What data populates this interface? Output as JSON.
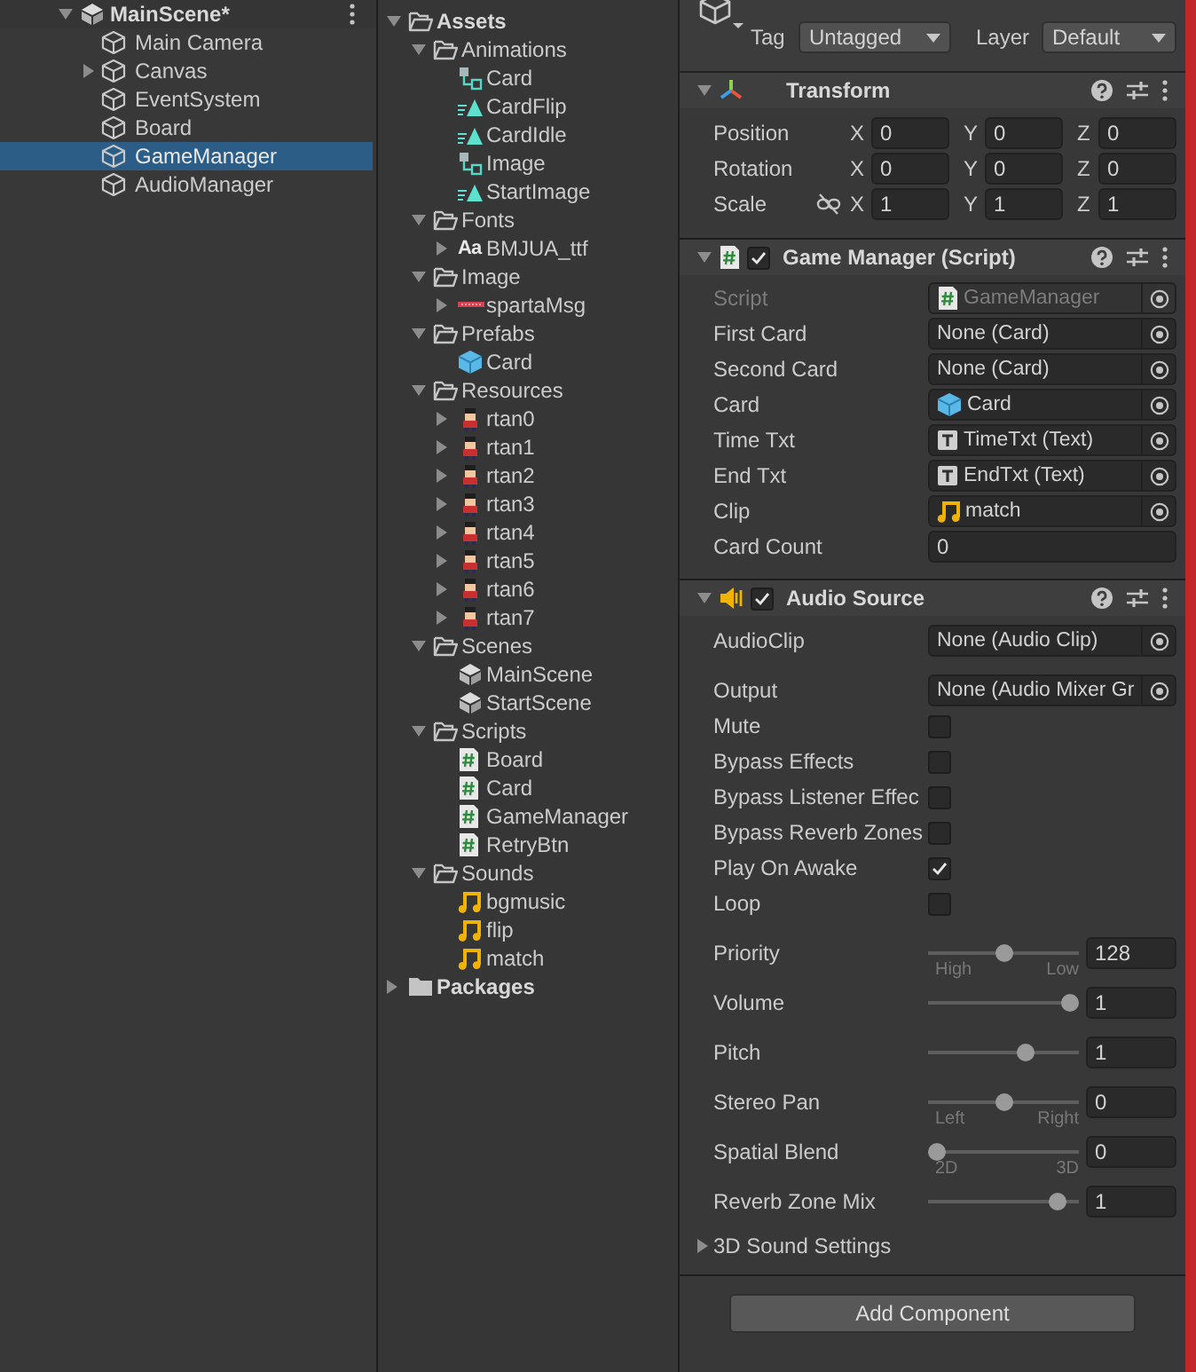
{
  "hierarchy": {
    "scene": {
      "name": "MainScene*",
      "expanded": true
    },
    "objects": [
      {
        "name": "Main Camera",
        "selected": false,
        "collapsed": false
      },
      {
        "name": "Canvas",
        "selected": false,
        "collapsed": true
      },
      {
        "name": "EventSystem",
        "selected": false,
        "collapsed": false
      },
      {
        "name": "Board",
        "selected": false,
        "collapsed": false
      },
      {
        "name": "GameManager",
        "selected": true,
        "collapsed": false
      },
      {
        "name": "AudioManager",
        "selected": false,
        "collapsed": false
      }
    ]
  },
  "project": {
    "tree": [
      {
        "name": "Assets",
        "kind": "folder",
        "expanded": true,
        "children": [
          {
            "name": "Animations",
            "kind": "folder",
            "expanded": true,
            "children": [
              {
                "name": "Card",
                "kind": "animator"
              },
              {
                "name": "CardFlip",
                "kind": "animclip"
              },
              {
                "name": "CardIdle",
                "kind": "animclip"
              },
              {
                "name": "Image",
                "kind": "animator"
              },
              {
                "name": "StartImage",
                "kind": "animclip"
              }
            ]
          },
          {
            "name": "Fonts",
            "kind": "folder",
            "expanded": true,
            "children": [
              {
                "name": "BMJUA_ttf",
                "kind": "font",
                "badge": "Aa",
                "expanded": false
              }
            ]
          },
          {
            "name": "Image",
            "kind": "folder",
            "expanded": true,
            "children": [
              {
                "name": "spartaMsg",
                "kind": "sprite",
                "expanded": false
              }
            ]
          },
          {
            "name": "Prefabs",
            "kind": "folder",
            "expanded": true,
            "children": [
              {
                "name": "Card",
                "kind": "prefab"
              }
            ]
          },
          {
            "name": "Resources",
            "kind": "folder",
            "expanded": true,
            "children": [
              {
                "name": "rtan0",
                "kind": "character",
                "expanded": false
              },
              {
                "name": "rtan1",
                "kind": "character",
                "expanded": false
              },
              {
                "name": "rtan2",
                "kind": "character",
                "expanded": false
              },
              {
                "name": "rtan3",
                "kind": "character",
                "expanded": false
              },
              {
                "name": "rtan4",
                "kind": "character",
                "expanded": false
              },
              {
                "name": "rtan5",
                "kind": "character",
                "expanded": false
              },
              {
                "name": "rtan6",
                "kind": "character",
                "expanded": false
              },
              {
                "name": "rtan7",
                "kind": "character",
                "expanded": false
              }
            ]
          },
          {
            "name": "Scenes",
            "kind": "folder",
            "expanded": true,
            "children": [
              {
                "name": "MainScene",
                "kind": "scene"
              },
              {
                "name": "StartScene",
                "kind": "scene"
              }
            ]
          },
          {
            "name": "Scripts",
            "kind": "folder",
            "expanded": true,
            "children": [
              {
                "name": "Board",
                "kind": "script"
              },
              {
                "name": "Card",
                "kind": "script"
              },
              {
                "name": "GameManager",
                "kind": "script"
              },
              {
                "name": "RetryBtn",
                "kind": "script"
              }
            ]
          },
          {
            "name": "Sounds",
            "kind": "folder",
            "expanded": true,
            "children": [
              {
                "name": "bgmusic",
                "kind": "audio"
              },
              {
                "name": "flip",
                "kind": "audio"
              },
              {
                "name": "match",
                "kind": "audio"
              }
            ]
          }
        ]
      },
      {
        "name": "Packages",
        "kind": "folder",
        "expanded": false
      }
    ]
  },
  "inspector": {
    "header": {
      "tag_label": "Tag",
      "tag": "Untagged",
      "layer_label": "Layer",
      "layer": "Default"
    },
    "components": [
      {
        "kind": "transform",
        "title": "Transform",
        "expanded": true,
        "rows": [
          {
            "label": "Position",
            "axes": [
              {
                "axis": "X",
                "value": "0"
              },
              {
                "axis": "Y",
                "value": "0"
              },
              {
                "axis": "Z",
                "value": "0"
              }
            ]
          },
          {
            "label": "Rotation",
            "axes": [
              {
                "axis": "X",
                "value": "0"
              },
              {
                "axis": "Y",
                "value": "0"
              },
              {
                "axis": "Z",
                "value": "0"
              }
            ]
          },
          {
            "label": "Scale",
            "constrain_proportions": false,
            "axes": [
              {
                "axis": "X",
                "value": "1"
              },
              {
                "axis": "Y",
                "value": "1"
              },
              {
                "axis": "Z",
                "value": "1"
              }
            ]
          }
        ]
      },
      {
        "kind": "script",
        "title": "Game Manager (Script)",
        "enabled": true,
        "expanded": true,
        "fields": [
          {
            "kind": "script",
            "label": "Script",
            "value": "GameManager",
            "disabled": true
          },
          {
            "kind": "object",
            "label": "First Card",
            "value": "None (Card)",
            "disabled": false
          },
          {
            "kind": "object",
            "label": "Second Card",
            "value": "None (Card)",
            "disabled": false
          },
          {
            "kind": "prefab",
            "label": "Card",
            "value": "Card",
            "disabled": false
          },
          {
            "kind": "text",
            "label": "Time Txt",
            "value": "TimeTxt (Text)",
            "disabled": false
          },
          {
            "kind": "text",
            "label": "End Txt",
            "value": "EndTxt (Text)",
            "disabled": false
          },
          {
            "kind": "audio",
            "label": "Clip",
            "value": "match",
            "disabled": false
          },
          {
            "kind": "number",
            "label": "Card Count",
            "value": "0"
          }
        ]
      },
      {
        "kind": "audio",
        "title": "Audio Source",
        "enabled": true,
        "expanded": true,
        "fields": [
          {
            "kind": "object",
            "label": "AudioClip",
            "value": "None (Audio Clip)",
            "disabled": false
          },
          {
            "kind": "object",
            "label": "Output",
            "value": "None (Audio Mixer Gr",
            "disabled": false
          },
          {
            "kind": "toggle",
            "label": "Mute",
            "checked": false
          },
          {
            "kind": "toggle",
            "label": "Bypass Effects",
            "checked": false
          },
          {
            "kind": "toggle",
            "label": "Bypass Listener Effec",
            "checked": false
          },
          {
            "kind": "toggle",
            "label": "Bypass Reverb Zones",
            "checked": false
          },
          {
            "kind": "toggle",
            "label": "Play On Awake",
            "checked": true
          },
          {
            "kind": "toggle",
            "label": "Loop",
            "checked": false
          },
          {
            "kind": "slider",
            "label": "Priority",
            "level": 0.5,
            "value": "128",
            "min_label": "High",
            "max_label": "Low"
          },
          {
            "kind": "slider",
            "label": "Volume",
            "level": 1,
            "value": "1"
          },
          {
            "kind": "slider",
            "label": "Pitch",
            "level": 0.667,
            "value": "1"
          },
          {
            "kind": "slider",
            "label": "Stereo Pan",
            "level": 0.5,
            "value": "0",
            "min_label": "Left",
            "max_label": "Right"
          },
          {
            "kind": "slider",
            "label": "Spatial Blend",
            "level": 0,
            "value": "0",
            "min_label": "2D",
            "max_label": "3D"
          },
          {
            "kind": "slider",
            "label": "Reverb Zone Mix",
            "level": 0.91,
            "value": "1"
          },
          {
            "kind": "foldout",
            "label": "3D Sound Settings",
            "expanded": false
          }
        ]
      }
    ],
    "add_component": "Add Component"
  }
}
